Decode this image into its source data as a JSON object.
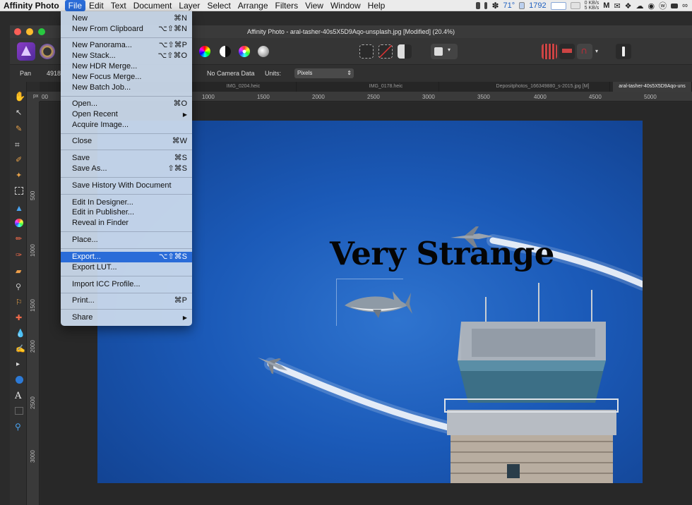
{
  "menubar": {
    "app_name": "Affinity Photo",
    "items": [
      "File",
      "Edit",
      "Text",
      "Document",
      "Layer",
      "Select",
      "Arrange",
      "Filters",
      "View",
      "Window",
      "Help"
    ],
    "active_item": "File",
    "status": {
      "temperature": "71°",
      "fan_speed": "1792",
      "net_up": "0 KB/s",
      "net_down": "5 KB/s"
    }
  },
  "window": {
    "title": "Affinity Photo - aral-tasher-40s5X5D9Aqo-unsplash.jpg [Modified] (20.4%)"
  },
  "context_bar": {
    "tool_name": "Pan",
    "dimension": "4918",
    "camera": "No Camera Data",
    "units_label": "Units:",
    "units_value": "Pixels"
  },
  "tabs": [
    {
      "label": "IMG_0204.heic"
    },
    {
      "label": "IMG_0178.heic"
    },
    {
      "label": "Depositphotos_166349880_s-2015.jpg [M]"
    },
    {
      "label": "aral-tasher-40s5X5D9Aqo-uns"
    }
  ],
  "ruler": {
    "unit": "px",
    "h_ticks": [
      "00",
      "1000",
      "1500",
      "2000",
      "2500",
      "3000",
      "3500",
      "4000",
      "4500",
      "5000"
    ],
    "v_ticks": [
      "500",
      "1000",
      "1500",
      "2000",
      "2500",
      "3000"
    ]
  },
  "canvas": {
    "headline_text": "Very Strange"
  },
  "file_menu": {
    "items": [
      {
        "label": "New",
        "shortcut": "⌘N"
      },
      {
        "label": "New From Clipboard",
        "shortcut": "⌥⇧⌘N"
      },
      {
        "label": "New Panorama...",
        "shortcut": "⌥⇧⌘P"
      },
      {
        "label": "New Stack...",
        "shortcut": "⌥⇧⌘O"
      },
      {
        "label": "New HDR Merge...",
        "shortcut": ""
      },
      {
        "label": "New Focus Merge...",
        "shortcut": ""
      },
      {
        "label": "New Batch Job...",
        "shortcut": ""
      },
      {
        "label": "Open...",
        "shortcut": "⌘O"
      },
      {
        "label": "Open Recent",
        "shortcut": "▶"
      },
      {
        "label": "Acquire Image...",
        "shortcut": ""
      },
      {
        "label": "Close",
        "shortcut": "⌘W"
      },
      {
        "label": "Save",
        "shortcut": "⌘S"
      },
      {
        "label": "Save As...",
        "shortcut": "⇧⌘S"
      },
      {
        "label": "Save History With Document",
        "shortcut": ""
      },
      {
        "label": "Edit In Designer...",
        "shortcut": ""
      },
      {
        "label": "Edit in Publisher...",
        "shortcut": ""
      },
      {
        "label": "Reveal in Finder",
        "shortcut": ""
      },
      {
        "label": "Place...",
        "shortcut": ""
      },
      {
        "label": "Export...",
        "shortcut": "⌥⇧⌘S"
      },
      {
        "label": "Export LUT...",
        "shortcut": ""
      },
      {
        "label": "Import ICC Profile...",
        "shortcut": ""
      },
      {
        "label": "Print...",
        "shortcut": "⌘P"
      },
      {
        "label": "Share",
        "shortcut": "▶"
      }
    ],
    "highlighted": "Export..."
  }
}
